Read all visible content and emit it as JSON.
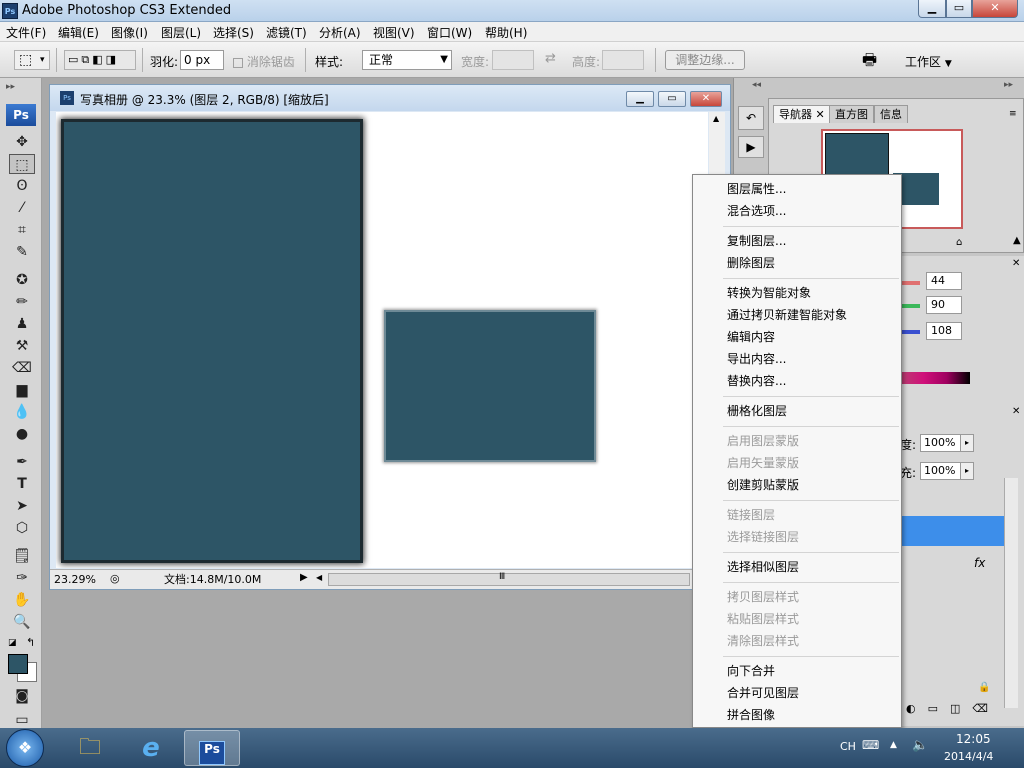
{
  "app": {
    "logo": "Ps",
    "title": "Adobe Photoshop CS3 Extended"
  },
  "menubar": {
    "items": [
      "文件(F)",
      "编辑(E)",
      "图像(I)",
      "图层(L)",
      "选择(S)",
      "滤镜(T)",
      "分析(A)",
      "视图(V)",
      "窗口(W)",
      "帮助(H)"
    ]
  },
  "options": {
    "feather_label": "羽化:",
    "feather_value": "0 px",
    "antialias_label": "消除锯齿",
    "style_label": "样式:",
    "style_value": "正常",
    "width_label": "宽度:",
    "height_label": "高度:",
    "refine_edge": "调整边缘...",
    "workspace": "工作区"
  },
  "document": {
    "title": "写真相册 @ 23.3% (图层 2, RGB/8) [缩放后]",
    "zoom": "23.29%",
    "info": "文档:14.8M/10.0M",
    "photo_color": "#2d5566"
  },
  "navigator": {
    "tabs": [
      "导航器",
      "直方图",
      "信息"
    ]
  },
  "color_panel": {
    "r": "44",
    "g": "90",
    "b": "108"
  },
  "layers_panel": {
    "opacity_label": "度:",
    "opacity_value": "100%",
    "fill_label": "充:",
    "fill_value": "100%",
    "fx_label": "fx"
  },
  "context_menu": {
    "items": [
      {
        "label": "图层属性...",
        "enabled": true
      },
      {
        "label": "混合选项...",
        "enabled": true
      },
      {
        "label": "复制图层...",
        "enabled": true
      },
      {
        "label": "删除图层",
        "enabled": true
      },
      {
        "label": "转换为智能对象",
        "enabled": true
      },
      {
        "label": "通过拷贝新建智能对象",
        "enabled": true
      },
      {
        "label": "编辑内容",
        "enabled": true
      },
      {
        "label": "导出内容...",
        "enabled": true
      },
      {
        "label": "替换内容...",
        "enabled": true
      },
      {
        "label": "栅格化图层",
        "enabled": true
      },
      {
        "label": "启用图层蒙版",
        "enabled": false
      },
      {
        "label": "启用矢量蒙版",
        "enabled": false
      },
      {
        "label": "创建剪贴蒙版",
        "enabled": true
      },
      {
        "label": "链接图层",
        "enabled": false
      },
      {
        "label": "选择链接图层",
        "enabled": false
      },
      {
        "label": "选择相似图层",
        "enabled": true
      },
      {
        "label": "拷贝图层样式",
        "enabled": false
      },
      {
        "label": "粘贴图层样式",
        "enabled": false
      },
      {
        "label": "清除图层样式",
        "enabled": false
      },
      {
        "label": "向下合并",
        "enabled": true
      },
      {
        "label": "合并可见图层",
        "enabled": true
      },
      {
        "label": "拼合图像",
        "enabled": true
      }
    ]
  },
  "taskbar": {
    "ime": "CH",
    "time": "12:05",
    "date": "2014/4/4",
    "ps_label": "Ps"
  }
}
